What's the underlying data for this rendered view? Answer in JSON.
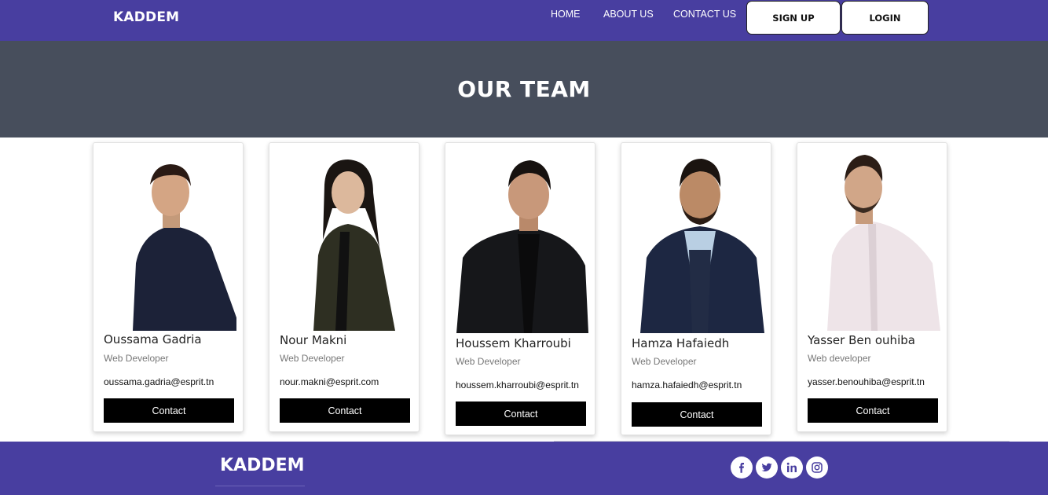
{
  "header": {
    "brand": "KADDEM",
    "nav": {
      "home": "HOME",
      "about": "ABOUT US",
      "contact": "CONTACT US"
    },
    "signup_label": "SIGN UP",
    "login_label": "LOGIN"
  },
  "hero": {
    "title": "OUR TEAM"
  },
  "team": [
    {
      "name": "Oussama Gadria",
      "role": "Web Developer",
      "email": "oussama.gadria@esprit.tn",
      "contact_label": "Contact"
    },
    {
      "name": "Nour Makni",
      "role": "Web Developer",
      "email": "nour.makni@esprit.com",
      "contact_label": "Contact"
    },
    {
      "name": "Houssem Kharroubi",
      "role": "Web Developer",
      "email": "houssem.kharroubi@esprit.tn",
      "contact_label": "Contact"
    },
    {
      "name": "Hamza Hafaiedh",
      "role": "Web Developer",
      "email": "hamza.hafaiedh@esprit.tn",
      "contact_label": "Contact"
    },
    {
      "name": "Yasser Ben ouhiba",
      "role": "Web developer",
      "email": "yasser.benouhiba@esprit.tn",
      "contact_label": "Contact"
    }
  ],
  "footer": {
    "brand": "KADDEM",
    "social_icons": [
      "facebook-icon",
      "twitter-icon",
      "linkedin-icon",
      "instagram-icon"
    ]
  },
  "colors": {
    "nav_bg": "#483ea0",
    "hero_bg": "#474e5c",
    "button_dark": "#000000"
  }
}
